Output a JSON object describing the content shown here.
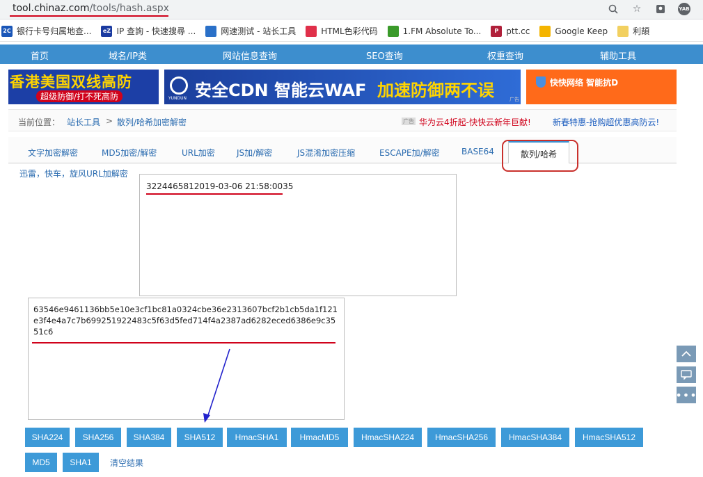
{
  "browser": {
    "url_host": "tool.chinaz.com",
    "url_path": "/tools/hash.aspx",
    "icons": [
      "search-zoom-icon",
      "star-bookmark-icon",
      "extension-icon",
      "profile-icon"
    ],
    "profile_label": "YAB"
  },
  "bookmarks": [
    {
      "icon_text": "2C",
      "color": "#1a56b8",
      "label": "银行卡号归属地查..."
    },
    {
      "icon_text": "eZ",
      "color": "#1a3aa0",
      "label": "IP 查詢 - 快速搜尋 ..."
    },
    {
      "icon_text": "",
      "color": "#2a70c8",
      "label": "网速测试 - 站长工具"
    },
    {
      "icon_text": "",
      "color": "#e0304a",
      "label": "HTML色彩代码"
    },
    {
      "icon_text": "",
      "color": "#3a9a2a",
      "label": "1.FM Absolute To..."
    },
    {
      "icon_text": "P",
      "color": "#b0203a",
      "label": "ptt.cc"
    },
    {
      "icon_text": "",
      "color": "#f4b400",
      "label": "Google Keep"
    },
    {
      "icon_text": "",
      "color": "#f2d060",
      "label": "利頡"
    }
  ],
  "nav": [
    "首页",
    "域名/IP类",
    "网站信息查询",
    "SEO查询",
    "权重查询",
    "辅助工具"
  ],
  "ads": {
    "ad1_line1": "香港美国双线高防",
    "ad1_line2": "超级防御/打不死高防",
    "ad2_logo": "YUNDUN",
    "ad2_text1": "安全CDN 智能云WAF",
    "ad2_text2": "加速防御两不误",
    "ad2_tag": "广告",
    "ad3_text": "快快网络  智能抗D"
  },
  "breadcrumb": {
    "prefix": "当前位置：",
    "home": "站长工具",
    "sep": ">",
    "current": "散列/哈希加密解密",
    "ad_tag": "广告",
    "promo1": "华为云4折起-快快云新年巨献!",
    "promo2": "新春特惠-抢购超优惠高防云!"
  },
  "tabs": [
    "文字加密解密",
    "MD5加密/解密",
    "URL加密",
    "JS加/解密",
    "JS混淆加密压缩",
    "ESCAPE加/解密",
    "BASE64"
  ],
  "active_tab": "散列/哈希",
  "sublink": "迅雷，快车，旋风URL加解密",
  "input_text": "3224465812019-03-06 21:58:0035",
  "output_text": "63546e9461136bb5e10e3cf1bc81a0324cbe36e2313607bcf2b1cb5da1f121e3f4e4a7c7b699251922483c5f63d5fed714f4a2387ad6282eced6386e9c3551c6",
  "buttons_row1": [
    "SHA224",
    "SHA256",
    "SHA384",
    "SHA512",
    "HmacSHA1",
    "HmacMD5",
    "HmacSHA224",
    "HmacSHA256",
    "HmacSHA384",
    "HmacSHA512"
  ],
  "buttons_row2": [
    "MD5",
    "SHA1"
  ],
  "clear_label": "清空结果"
}
